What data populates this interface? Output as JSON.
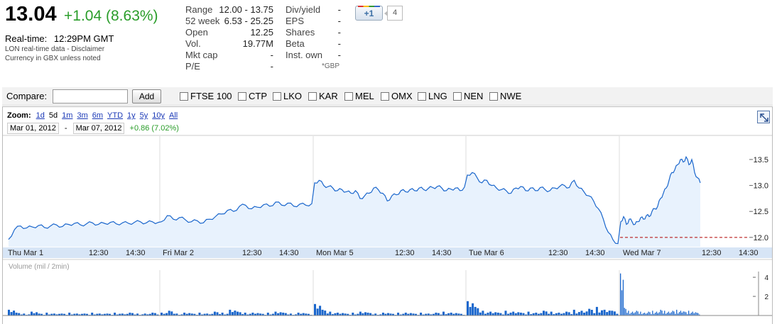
{
  "quote": {
    "price": "13.04",
    "change": "+1.04 (8.63%)",
    "realtime_label": "Real-time:",
    "realtime_time": "12:29PM GMT",
    "data_note": "LON real-time data - Disclaimer",
    "currency_note": "Currency in GBX unless noted"
  },
  "stats_left": [
    {
      "label": "Range",
      "value": "12.00 - 13.75"
    },
    {
      "label": "52 week",
      "value": "6.53 - 25.25"
    },
    {
      "label": "Open",
      "value": "12.25"
    },
    {
      "label": "Vol.",
      "value": "19.77M"
    },
    {
      "label": "Mkt cap",
      "value": "-"
    },
    {
      "label": "P/E",
      "value": "-"
    }
  ],
  "stats_right": [
    {
      "label": "Div/yield",
      "value": "-"
    },
    {
      "label": "EPS",
      "value": "-"
    },
    {
      "label": "Shares",
      "value": "-"
    },
    {
      "label": "Beta",
      "value": "-"
    },
    {
      "label": "Inst. own",
      "value": "-"
    }
  ],
  "stats_note": "*GBP",
  "plusone": {
    "label": "+1",
    "count": "4"
  },
  "compare": {
    "label": "Compare:",
    "input_value": "",
    "add_label": "Add",
    "items": [
      "FTSE 100",
      "CTP",
      "LKO",
      "KAR",
      "MEL",
      "OMX",
      "LNG",
      "NEN",
      "NWE"
    ]
  },
  "zoom": {
    "label": "Zoom:",
    "options": [
      "1d",
      "5d",
      "1m",
      "3m",
      "6m",
      "YTD",
      "1y",
      "5y",
      "10y",
      "All"
    ],
    "active": "5d"
  },
  "range": {
    "start": "Mar 01, 2012",
    "separator": "-",
    "end": "Mar 07, 2012",
    "change": "+0.86 (7.02%)"
  },
  "colors": {
    "accent_green": "#2a9d2a",
    "line_blue": "#1a66cc",
    "fill_blue": "#e8f2fd",
    "prev_close_red": "#b00000"
  },
  "chart_data": {
    "type": "line",
    "price_axis": {
      "ticks": [
        12.0,
        12.5,
        13.0,
        13.5
      ],
      "tick_labels": [
        "12.0",
        "12.5",
        "13.0",
        "13.5"
      ],
      "ylim": [
        11.82,
        13.95
      ]
    },
    "previous_close": 12.0,
    "time_axis_labels": [
      "Thu Mar 1",
      "12:30",
      "14:30",
      "Fri Mar 2",
      "12:30",
      "14:30",
      "Mon Mar 5",
      "12:30",
      "14:30",
      "Tue Mar 6",
      "12:30",
      "14:30",
      "Wed Mar 7",
      "12:30",
      "14:30"
    ],
    "price_series": [
      {
        "day": "Thu Mar 1",
        "values": [
          11.96,
          12.15,
          12.22,
          12.18,
          12.2,
          12.23,
          12.19,
          12.22,
          12.24,
          12.21,
          12.25,
          12.27,
          12.24,
          12.26,
          12.28,
          12.25,
          12.27,
          12.29,
          12.26,
          12.28,
          12.27,
          12.29,
          12.3,
          12.28,
          12.3,
          12.29
        ]
      },
      {
        "day": "Fri Mar 2",
        "values": [
          12.3,
          12.42,
          12.35,
          12.38,
          12.34,
          12.3,
          12.32,
          12.28,
          12.35,
          12.4,
          12.45,
          12.52,
          12.5,
          12.6,
          12.62,
          12.55,
          12.58,
          12.63,
          12.6,
          12.68,
          12.62,
          12.66,
          12.6,
          12.64,
          12.62,
          12.65
        ]
      },
      {
        "day": "Mon Mar 5",
        "values": [
          13.05,
          13.1,
          13.0,
          12.98,
          12.95,
          12.9,
          12.92,
          12.88,
          12.85,
          12.9,
          12.75,
          12.8,
          12.85,
          12.95,
          12.92,
          12.85,
          12.7,
          12.8,
          12.82,
          12.9,
          12.88,
          12.92,
          12.9,
          12.95,
          12.92,
          12.94,
          12.96,
          12.98,
          12.95,
          12.9,
          12.93,
          12.95,
          12.9,
          12.97
        ]
      },
      {
        "day": "Tue Mar 6",
        "values": [
          13.2,
          13.25,
          13.15,
          13.05,
          13.1,
          13.0,
          12.95,
          12.92,
          12.9,
          12.85,
          12.95,
          12.98,
          12.9,
          12.95,
          12.9,
          12.96,
          12.92,
          12.9,
          12.95,
          12.98,
          13.0,
          12.96,
          13.1,
          12.95,
          12.88,
          12.8,
          12.7,
          12.55,
          12.35,
          12.1,
          11.95,
          11.88
        ]
      },
      {
        "day": "Wed Mar 7",
        "values": [
          12.3,
          12.4,
          12.25,
          12.35,
          12.3,
          12.25,
          12.3,
          12.38,
          12.35,
          12.42,
          12.4,
          12.5,
          12.55,
          12.6,
          12.75,
          12.85,
          12.95,
          13.1,
          13.25,
          13.3,
          13.4,
          13.5,
          13.45,
          13.55,
          13.4,
          13.5,
          13.25,
          13.15,
          13.05
        ]
      }
    ],
    "volume_axis": {
      "label": "Volume (mil / 2min)",
      "ticks": [
        2,
        4
      ],
      "tick_labels": [
        "2",
        "4"
      ],
      "ylim": [
        0,
        4.6
      ]
    },
    "volume_series": [
      {
        "day": "Thu Mar 1",
        "values": [
          0.6,
          0.3,
          0.2,
          0.4,
          0.2,
          0.3,
          0.2,
          0.2,
          0.3,
          0.2,
          0.2,
          0.3,
          0.2,
          0.2,
          0.3,
          0.2,
          0.3,
          0.2,
          0.2,
          0.3
        ]
      },
      {
        "day": "Fri Mar 2",
        "values": [
          0.3,
          0.5,
          0.2,
          0.3,
          0.2,
          0.3,
          0.2,
          0.4,
          0.3,
          0.6,
          0.4,
          0.3,
          0.3,
          0.2,
          0.3,
          0.4,
          0.3,
          0.2,
          0.3,
          0.2
        ]
      },
      {
        "day": "Mon Mar 5",
        "values": [
          1.2,
          0.6,
          0.4,
          0.3,
          0.2,
          0.3,
          0.4,
          0.3,
          0.2,
          0.3,
          0.2,
          0.3,
          0.3,
          0.2,
          0.3,
          0.2,
          0.3,
          0.4,
          0.3,
          0.2
        ]
      },
      {
        "day": "Tue Mar 6",
        "values": [
          1.5,
          0.9,
          0.5,
          0.4,
          0.3,
          0.5,
          0.4,
          0.3,
          0.4,
          0.3,
          0.5,
          0.4,
          0.3,
          0.4,
          0.6,
          0.5,
          0.7,
          0.9,
          0.6,
          0.5
        ]
      },
      {
        "day": "Wed Mar 7",
        "values": [
          4.4,
          0.8,
          0.5,
          0.4,
          0.5,
          0.4,
          0.3,
          0.4,
          0.5,
          0.4,
          0.6,
          0.5,
          0.4,
          0.5,
          0.6,
          0.5,
          0.4,
          0.5,
          0.4,
          0.3
        ]
      }
    ]
  }
}
